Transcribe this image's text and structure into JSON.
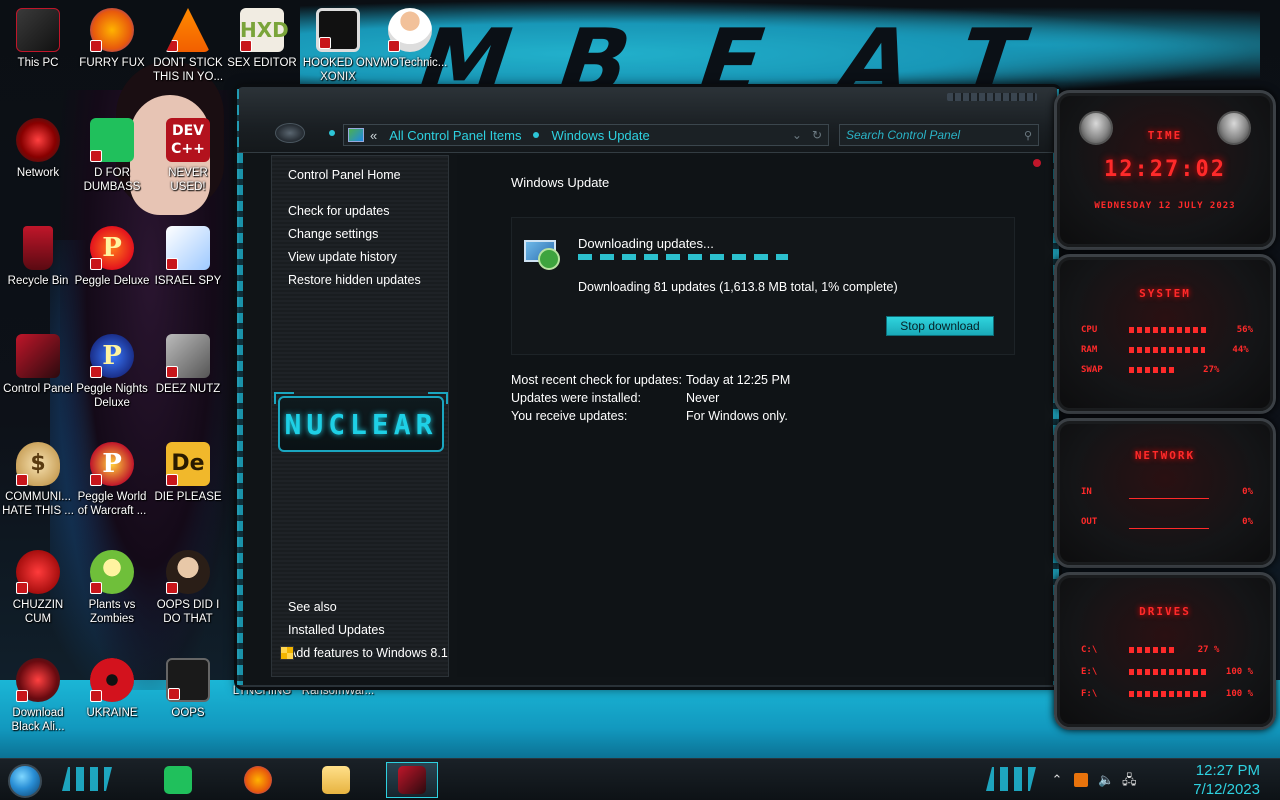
{
  "desktop": {
    "icons": [
      {
        "label": "This PC"
      },
      {
        "label": "FURRY FUX"
      },
      {
        "label": "DONT STICK THIS IN YO..."
      },
      {
        "label": "SEX EDITOR"
      },
      {
        "label": "HOOKED ON XONIX"
      },
      {
        "label": "VMOTechnic..."
      },
      {
        "label": "Network"
      },
      {
        "label": "D FOR DUMBASS"
      },
      {
        "label": "NEVER USED!"
      },
      {
        "label": "Recycle Bin"
      },
      {
        "label": "Peggle Deluxe"
      },
      {
        "label": "ISRAEL SPY"
      },
      {
        "label": "Control Panel"
      },
      {
        "label": "Peggle Nights Deluxe"
      },
      {
        "label": "DEEZ NUTZ"
      },
      {
        "label": "COMMUNI... HATE THIS ..."
      },
      {
        "label": "Peggle World of Warcraft ..."
      },
      {
        "label": "DIE PLEASE"
      },
      {
        "label": "CHUZZIN CUM"
      },
      {
        "label": "Plants vs Zombies"
      },
      {
        "label": "OOPS DID I DO THAT"
      },
      {
        "label": "Download Black Ali..."
      },
      {
        "label": "UKRAINE"
      },
      {
        "label": "OOPS"
      },
      {
        "label": "LYNCHING"
      },
      {
        "label": "RansomWar..."
      }
    ],
    "dev_badge": "DEV\nC++"
  },
  "window": {
    "breadcrumb": {
      "chevron": "«",
      "items": [
        "All Control Panel Items",
        "Windows Update"
      ]
    },
    "search": {
      "placeholder": "Search Control Panel"
    },
    "sidebar": {
      "home": "Control Panel Home",
      "links": [
        "Check for updates",
        "Change settings",
        "View update history",
        "Restore hidden updates"
      ],
      "logo_text": "NUCLEAR",
      "see_also_label": "See also",
      "see_also": [
        "Installed Updates",
        "Add features to Windows 8.1"
      ]
    },
    "content": {
      "title": "Windows Update",
      "status_heading": "Downloading updates...",
      "progress_percent": 1,
      "detail": "Downloading 81 updates (1,613.8 MB total, 1% complete)",
      "stop_button": "Stop download",
      "info": [
        {
          "key": "Most recent check for updates:",
          "value": "Today at 12:25 PM"
        },
        {
          "key": "Updates were installed:",
          "value": "Never"
        },
        {
          "key": "You receive updates:",
          "value": "For Windows only."
        }
      ]
    }
  },
  "gadgets": {
    "time": {
      "title": "TIME",
      "clock": "12:27:02",
      "date": "WEDNESDAY 12 JULY 2023"
    },
    "system": {
      "title": "SYSTEM",
      "rows": [
        {
          "name": "CPU",
          "value": "56%",
          "level": 56
        },
        {
          "name": "RAM",
          "value": "44%",
          "level": 44
        },
        {
          "name": "SWAP",
          "value": "27%",
          "level": 27
        }
      ]
    },
    "network": {
      "title": "NETWORK",
      "rows": [
        {
          "name": "IN",
          "value": "0%"
        },
        {
          "name": "OUT",
          "value": "0%"
        }
      ]
    },
    "drives": {
      "title": "DRIVES",
      "rows": [
        {
          "name": "C:\\",
          "value": "27 %",
          "level": 27
        },
        {
          "name": "E:\\",
          "value": "100 %",
          "level": 100
        },
        {
          "name": "F:\\",
          "value": "100 %",
          "level": 100
        }
      ]
    }
  },
  "taskbar": {
    "apps": [
      "sticky-notes",
      "firefox",
      "file-explorer",
      "control-panel"
    ],
    "clock_time": "12:27 PM",
    "clock_date": "7/12/2023"
  },
  "colors": {
    "accent": "#2ed1e0",
    "gadget_red": "#ff2a2a",
    "window_bg": "#101417"
  }
}
